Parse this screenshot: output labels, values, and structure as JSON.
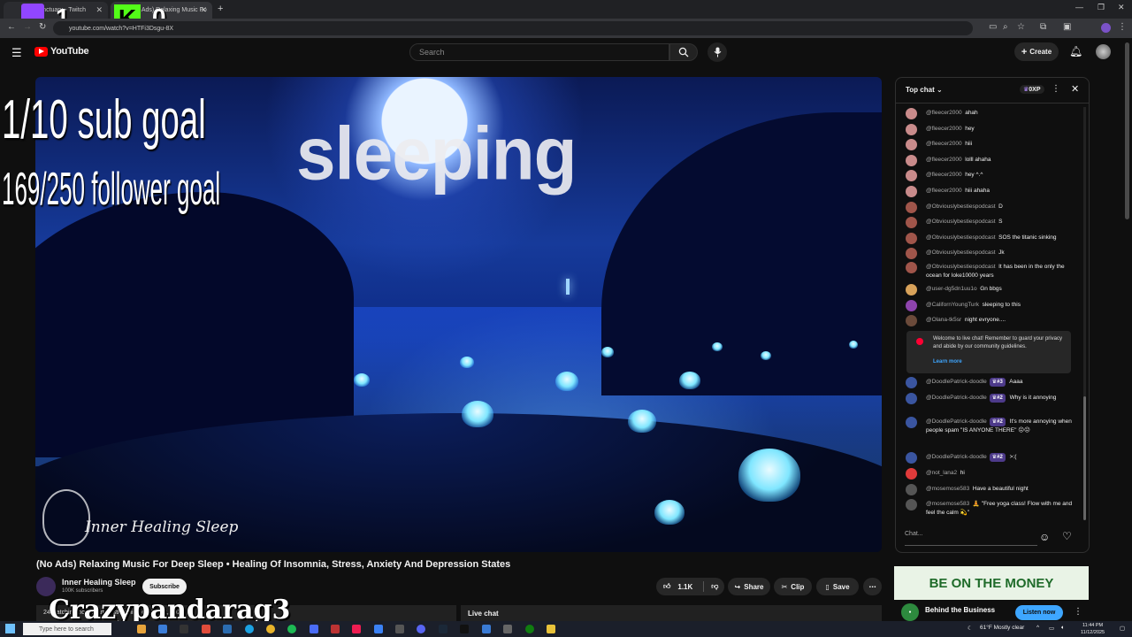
{
  "browser": {
    "tabs": [
      {
        "label": "yourSanctuary - Twitch",
        "active": false
      },
      {
        "label": "(No Ads) Relaxing Music Fo",
        "active": true
      }
    ],
    "url": "youtube.com/watch?v=HTFi3Dsgu-8X"
  },
  "youtube": {
    "logo": "YouTube",
    "search_placeholder": "Search",
    "create_label": "Create"
  },
  "stream_overlay": {
    "counter_left": "1",
    "kick_letter": "K",
    "counter_right": "0",
    "sub_goal": "1/10 sub goal",
    "follower_goal": "169/250 follower goal",
    "status_text": "sleeping",
    "streamer_name": "Crazypandarag3"
  },
  "video": {
    "brand_text": "Inner Healing Sleep",
    "title": "(No Ads) Relaxing Music For Deep Sleep • Healing Of Insomnia, Stress, Anxiety And Depression States",
    "channel": "Inner Healing Sleep",
    "subscribers": "100K subscribers",
    "subscribe_label": "Subscribe",
    "likes": "1.1K",
    "share_label": "Share",
    "clip_label": "Clip",
    "save_label": "Save",
    "watching_text": "24 watching now  Started streaming on Jul 12, 2025",
    "live_chat_label": "Live chat"
  },
  "chat": {
    "header": "Top chat",
    "xp_badge": "0XP",
    "messages": [
      {
        "author": "@fleecer2000",
        "text": "ahah",
        "color": "#c98b8b"
      },
      {
        "author": "@fleecer2000",
        "text": "hey",
        "color": "#c98b8b"
      },
      {
        "author": "@fleecer2000",
        "text": "hiii",
        "color": "#c98b8b"
      },
      {
        "author": "@fleecer2000",
        "text": "lolll ahaha",
        "color": "#c98b8b"
      },
      {
        "author": "@fleecer2000",
        "text": "hey ^.^",
        "color": "#c98b8b"
      },
      {
        "author": "@fleecer2000",
        "text": "hiii ahaha",
        "color": "#c98b8b"
      },
      {
        "author": "@Obviouslybestiespodcast",
        "text": "D",
        "color": "#a0554a"
      },
      {
        "author": "@Obviouslybestiespodcast",
        "text": "S",
        "color": "#a0554a"
      },
      {
        "author": "@Obviouslybestiespodcast",
        "text": "SOS the titanic sinking",
        "color": "#a0554a"
      },
      {
        "author": "@Obviouslybestiespodcast",
        "text": "Jk",
        "color": "#a0554a"
      },
      {
        "author": "@Obviouslybestiespodcast",
        "text": "It has been in the only the ocean for loke10000 years",
        "color": "#a0554a"
      },
      {
        "author": "@user-dg5dn1uu1o",
        "text": "Gn bbgs",
        "color": "#d8a25a"
      },
      {
        "author": "@CalifornYoungTurk",
        "text": "sleeping to this",
        "color": "#8e44ad"
      },
      {
        "author": "@Olana-tk5sr",
        "text": "night evryone....",
        "color": "#6b4a3a"
      }
    ],
    "welcome": {
      "text": "Welcome to live chat! Remember to guard your privacy and abide by our community guidelines.",
      "link": "Learn more"
    },
    "messages2": [
      {
        "author": "@DoodlePatrick-doodle",
        "rank": "#3",
        "text": "Aaaa",
        "color": "#3a55a0"
      },
      {
        "author": "@DoodlePatrick-doodle",
        "rank": "#2",
        "text": "Why is it annoying",
        "color": "#3a55a0"
      },
      {
        "author": "@DoodlePatrick-doodle",
        "rank": "#2",
        "text": "It's more annoying when people spam \"IS ANYONE THERE\" 😖😖",
        "color": "#3a55a0"
      },
      {
        "author": "@DoodlePatrick-doodle",
        "rank": "#2",
        "text": ">:(",
        "color": "#3a55a0"
      },
      {
        "author": "@not_lana2",
        "rank": "",
        "text": "hi",
        "color": "#e03a3a"
      },
      {
        "author": "@mosemose583",
        "rank": "",
        "text": "Have a beautiful night",
        "color": "#555555"
      },
      {
        "author": "@mosemose583",
        "rank": "",
        "text": "🧘 \"Free yoga class! Flow with me and feel the calm 💫\"",
        "color": "#555555"
      }
    ],
    "input_placeholder": "Chat..."
  },
  "ad": {
    "banner": "BE ON THE MONEY",
    "title": "Behind the Business",
    "cta": "Listen now"
  },
  "taskbar": {
    "search_placeholder": "Type here to search",
    "weather": "61°F  Mostly clear",
    "time": "11:44 PM",
    "date": "11/12/2025"
  },
  "colors": {
    "youtube_red": "#ff0000",
    "kick_green": "#53fc18",
    "twitch_purple": "#9146ff",
    "link_blue": "#3ea6ff"
  }
}
